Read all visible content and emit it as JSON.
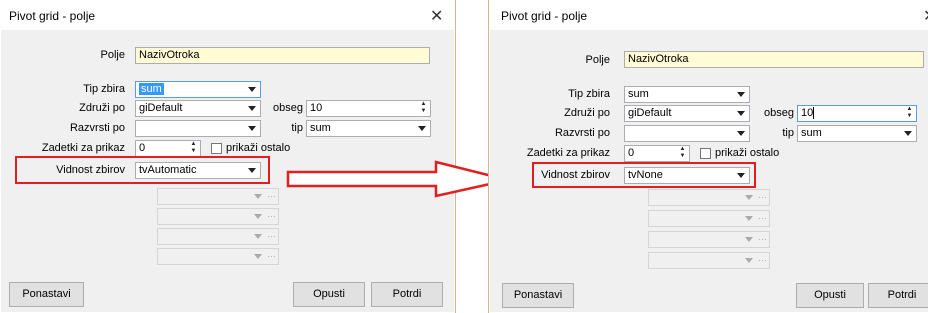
{
  "left": {
    "title": "Pivot grid - polje",
    "close": "✕",
    "polje_label": "Polje",
    "polje_value": "NazivOtroka",
    "tip_zbira_label": "Tip zbira",
    "tip_zbira_value": "sum",
    "zdruzi_po_label": "Združi po",
    "zdruzi_po_value": "giDefault",
    "obseg_label": "obseg",
    "obseg_value": "10",
    "razvrsti_po_label": "Razvrsti po",
    "razvrsti_po_value": "",
    "tip_label": "tip",
    "tip_value": "sum",
    "zadetki_label": "Zadetki za prikaz",
    "zadetki_value": "0",
    "prikazi_ostalo_label": "prikaži ostalo",
    "vidnost_label": "Vidnost zbirov",
    "vidnost_value": "tvAutomatic",
    "ponastavi": "Ponastavi",
    "opusti": "Opusti",
    "potrdi": "Potrdi"
  },
  "right": {
    "title": "Pivot grid - polje",
    "close": "✕",
    "polje_label": "Polje",
    "polje_value": "NazivOtroka",
    "tip_zbira_label": "Tip zbira",
    "tip_zbira_value": "sum",
    "zdruzi_po_label": "Združi po",
    "zdruzi_po_value": "giDefault",
    "obseg_label": "obseg",
    "obseg_value": "10",
    "razvrsti_po_label": "Razvrsti po",
    "razvrsti_po_value": "",
    "tip_label": "tip",
    "tip_value": "sum",
    "zadetki_label": "Zadetki za prikaz",
    "zadetki_value": "0",
    "prikazi_ostalo_label": "prikaži ostalo",
    "vidnost_label": "Vidnost zbirov",
    "vidnost_value": "tvNone",
    "ponastavi": "Ponastavi",
    "opusti": "Opusti",
    "potrdi": "Potrdi"
  },
  "colors": {
    "highlight": "#e02020",
    "selection": "#3399ff",
    "required_field": "#fffbd5"
  },
  "icons": {
    "dropdown": "chevron-down-icon",
    "spinner": "spinner-icon",
    "ellipsis": "ellipsis-icon"
  }
}
